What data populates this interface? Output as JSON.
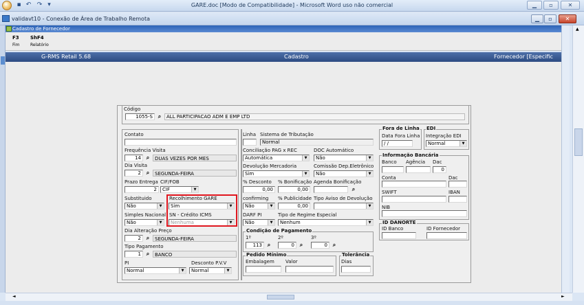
{
  "word": {
    "title": "GARE.doc [Modo de Compatibilidade] - Microsoft Word uso não comercial"
  },
  "remote": {
    "title": "validavt10 - Conexão de Área de Trabalho Remota"
  },
  "app": {
    "window_title": "Cadastro de Fornecedor",
    "toolbar": [
      {
        "key": "F3",
        "sub": "Fim"
      },
      {
        "key": "ShF4",
        "sub": "Relatório"
      }
    ],
    "header": {
      "left": "G-RMS Retail 5.68",
      "center": "Cadastro",
      "right": "Fornecedor [Especific"
    }
  },
  "form": {
    "codigo": {
      "label": "Código",
      "value": "1055-S",
      "name": "ALL PARTICIPACAO ADM E EMP LTD"
    },
    "contato": {
      "label": "Contato",
      "value": ""
    },
    "frequencia": {
      "label": "Frequência Visita",
      "value": "14",
      "desc": "DUAS VEZES POR MES"
    },
    "dia_visita": {
      "label": "Dia Visita",
      "value": "2",
      "desc": "SEGUNDA-FEIRA"
    },
    "prazo": {
      "label": "Prazo Entrega",
      "value": "2"
    },
    "cif": {
      "label": "CIF/FOB",
      "value": "CIF"
    },
    "substituido": {
      "label": "Substituido",
      "value": "Não"
    },
    "recolhimento": {
      "label": "Recolhimento GARE",
      "value": "Sim"
    },
    "simples": {
      "label": "Simples Nacional",
      "value": "Não"
    },
    "sn_credito": {
      "label": "SN - Crédito ICMS",
      "value": "Nenhuma"
    },
    "dia_alteracao": {
      "label": "Dia Alteração Preço",
      "value": "2",
      "desc": "SEGUNDA-FEIRA"
    },
    "tipo_pagamento": {
      "label": "Tipo Pagamento",
      "value": "1",
      "desc": "BANCO"
    },
    "pi": {
      "label": "PI",
      "value": "Normal"
    },
    "desconto_pvv": {
      "label": "Desconto P.V.V",
      "value": "Normal"
    },
    "linha": {
      "label": "Linha",
      "value": ""
    },
    "sistema_tributacao": {
      "label": "Sistema de Tributação",
      "value": "Normal"
    },
    "conciliacao": {
      "label": "Conciliação PAG x REC",
      "value": "Automática"
    },
    "doc_automatico": {
      "label": "DOC Automático",
      "value": "Não"
    },
    "devolucao": {
      "label": "Devolução Mercadoria",
      "value": "Sim"
    },
    "comissao": {
      "label": "Comissão Dep.Eletrônico",
      "value": "Não"
    },
    "pct_desconto": {
      "label": "% Desconto",
      "value": "0,00"
    },
    "pct_bonificacao": {
      "label": "% Bonificação",
      "value": "0,00"
    },
    "agenda": {
      "label": "Agenda Bonificação",
      "value": ""
    },
    "confirming": {
      "label": "confirming",
      "value": "Não"
    },
    "pct_publicidade": {
      "label": "% Publicidade",
      "value": "0,00"
    },
    "tipo_aviso": {
      "label": "Tipo Aviso de Devolução",
      "value": ""
    },
    "darf_pi": {
      "label": "DARF PI",
      "value": "Não"
    },
    "tipo_regime": {
      "label": "Tipo de Regime Especial",
      "value": "Nenhum"
    },
    "condicao": {
      "label": "Condição de Pagamento",
      "c1": "1º",
      "c2": "2º",
      "c3": "3º",
      "v1": "113",
      "v2": "0",
      "v3": "0"
    },
    "pedido": {
      "label": "Pedido Mínimo",
      "embalagem": "Embalagem",
      "valor": "Valor"
    },
    "tolerancia": {
      "label": "Tolerância",
      "dias": "Dias"
    },
    "fora_linha": {
      "label": "Fora de Linha",
      "data_label": "Data Fora Linha",
      "value": "/ /"
    },
    "edi": {
      "label": "EDI",
      "integracao_label": "Integração EDI",
      "value": "Normal"
    },
    "banco": {
      "label": "Informação Bancária",
      "banco": "Banco",
      "agencia": "Agência",
      "dac": "Dac",
      "dac_value": "0",
      "conta": "Conta",
      "dac2": "Dac",
      "swift": "SWIFT",
      "iban": "IBAN",
      "nib": "NIB"
    },
    "danorte": {
      "label": "ID DANORTE",
      "id_banco": "ID Banco",
      "id_fornecedor": "ID Fornecedor"
    }
  },
  "colors": {
    "highlight": "#e0161e",
    "header": "#2c4b82"
  }
}
